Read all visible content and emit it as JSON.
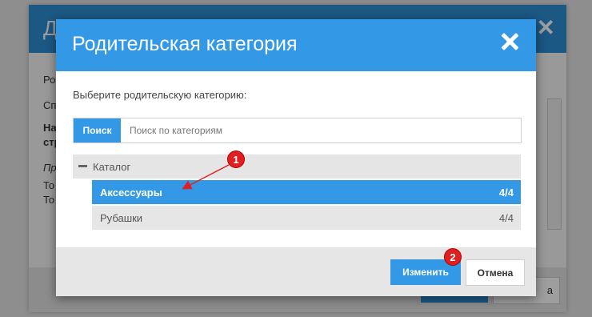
{
  "background": {
    "dialog_title_fragment": "Д",
    "text_lines": [
      {
        "text": "Ро",
        "style": "normal"
      },
      {
        "text": "Сп",
        "style": "normal"
      },
      {
        "text": "На",
        "style": "bold"
      },
      {
        "text": "стр",
        "style": "bold"
      },
      {
        "text": "Пр",
        "style": "italic"
      },
      {
        "text": "То",
        "style": "normal"
      },
      {
        "text": "То",
        "style": "normal"
      }
    ],
    "footer_button_fragment": "a"
  },
  "modal": {
    "title": "Родительская категория",
    "prompt": "Выберите родительскую категорию:",
    "search": {
      "button_label": "Поиск",
      "placeholder": "Поиск по категориям",
      "value": ""
    },
    "tree": {
      "root_label": "Каталог",
      "children": [
        {
          "name": "Аксессуары",
          "count": "4/4",
          "selected": true
        },
        {
          "name": "Рубашки",
          "count": "4/4",
          "selected": false
        }
      ]
    },
    "buttons": {
      "confirm": "Изменить",
      "cancel": "Отмена"
    }
  },
  "annotations": {
    "marker_1": "1",
    "marker_2": "2",
    "marker_color": "#e02020"
  },
  "colors": {
    "accent": "#3399e6",
    "footer_bg": "#e6e6e6"
  }
}
